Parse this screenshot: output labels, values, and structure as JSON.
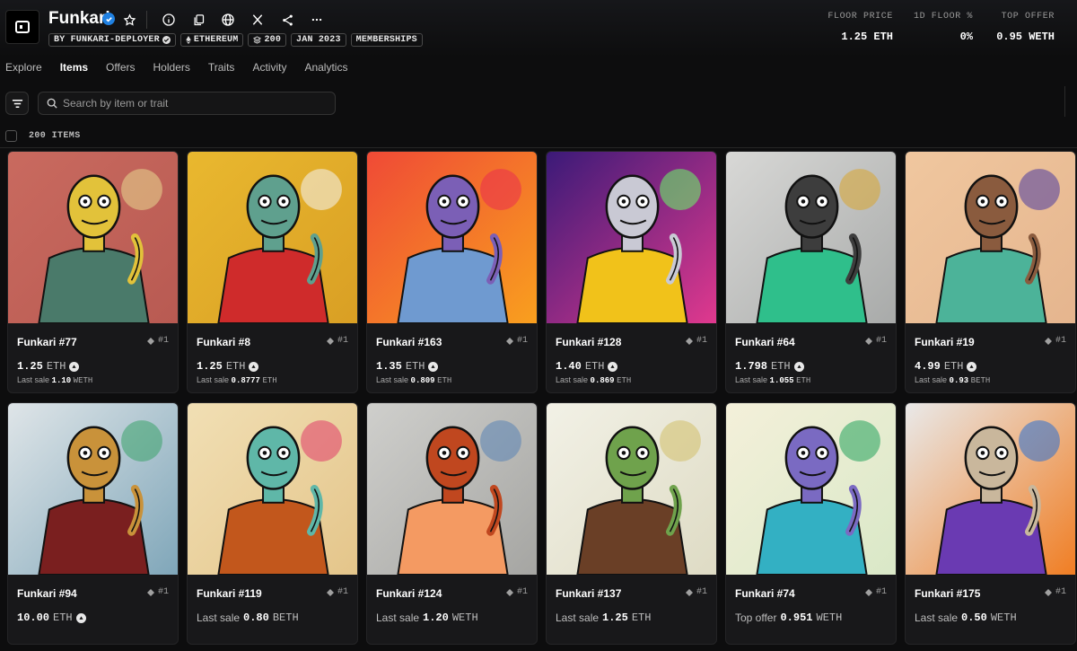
{
  "collection": {
    "name": "Funkari",
    "chips": [
      {
        "label": "BY FUNKARI-DEPLOYER",
        "icon": "check-badge-icon"
      },
      {
        "label": "ETHEREUM",
        "icon": "ethereum-icon"
      },
      {
        "label": "200",
        "icon": "stack-icon"
      },
      {
        "label": "JAN 2023",
        "icon": ""
      },
      {
        "label": "MEMBERSHIPS",
        "icon": ""
      }
    ]
  },
  "stats": {
    "floor_price": {
      "label": "FLOOR PRICE",
      "value": "1.25 ETH"
    },
    "floor_change": {
      "label": "1D FLOOR %",
      "value": "0%"
    },
    "top_offer": {
      "label": "TOP OFFER",
      "value": "0.95 WETH"
    }
  },
  "tabs": [
    "Explore",
    "Items",
    "Offers",
    "Holders",
    "Traits",
    "Activity",
    "Analytics"
  ],
  "active_tab": "Items",
  "search": {
    "placeholder": "Search by item or trait"
  },
  "items_count": "200 ITEMS",
  "items": [
    {
      "name": "Funkari #77",
      "rank": "#1",
      "price_label": "",
      "price": "1.25",
      "currency": "ETH",
      "last_sale_label": "Last sale",
      "last_sale": "1.10",
      "last_sale_currency": "WETH"
    },
    {
      "name": "Funkari #8",
      "rank": "#1",
      "price_label": "",
      "price": "1.25",
      "currency": "ETH",
      "last_sale_label": "Last sale",
      "last_sale": "0.8777",
      "last_sale_currency": "ETH"
    },
    {
      "name": "Funkari #163",
      "rank": "#1",
      "price_label": "",
      "price": "1.35",
      "currency": "ETH",
      "last_sale_label": "Last sale",
      "last_sale": "0.809",
      "last_sale_currency": "ETH"
    },
    {
      "name": "Funkari #128",
      "rank": "#1",
      "price_label": "",
      "price": "1.40",
      "currency": "ETH",
      "last_sale_label": "Last sale",
      "last_sale": "0.869",
      "last_sale_currency": "ETH"
    },
    {
      "name": "Funkari #64",
      "rank": "#1",
      "price_label": "",
      "price": "1.798",
      "currency": "ETH",
      "last_sale_label": "Last sale",
      "last_sale": "1.055",
      "last_sale_currency": "ETH"
    },
    {
      "name": "Funkari #19",
      "rank": "#1",
      "price_label": "",
      "price": "4.99",
      "currency": "ETH",
      "last_sale_label": "Last sale",
      "last_sale": "0.93",
      "last_sale_currency": "BETH"
    },
    {
      "name": "Funkari #94",
      "rank": "#1",
      "price_label": "",
      "price": "10.00",
      "currency": "ETH",
      "last_sale_label": "",
      "last_sale": "",
      "last_sale_currency": ""
    },
    {
      "name": "Funkari #119",
      "rank": "#1",
      "price_label": "Last sale",
      "price": "0.80",
      "currency": "BETH",
      "last_sale_label": "",
      "last_sale": "",
      "last_sale_currency": ""
    },
    {
      "name": "Funkari #124",
      "rank": "#1",
      "price_label": "Last sale",
      "price": "1.20",
      "currency": "WETH",
      "last_sale_label": "",
      "last_sale": "",
      "last_sale_currency": ""
    },
    {
      "name": "Funkari #137",
      "rank": "#1",
      "price_label": "Last sale",
      "price": "1.25",
      "currency": "ETH",
      "last_sale_label": "",
      "last_sale": "",
      "last_sale_currency": ""
    },
    {
      "name": "Funkari #74",
      "rank": "#1",
      "price_label": "Top offer",
      "price": "0.951",
      "currency": "WETH",
      "last_sale_label": "",
      "last_sale": "",
      "last_sale_currency": ""
    },
    {
      "name": "Funkari #175",
      "rank": "#1",
      "price_label": "Last sale",
      "price": "0.50",
      "currency": "WETH",
      "last_sale_label": "",
      "last_sale": "",
      "last_sale_currency": ""
    }
  ],
  "colors": {
    "background": "#0d0d0e",
    "card": "#18181a",
    "verified": "#2081e2"
  }
}
